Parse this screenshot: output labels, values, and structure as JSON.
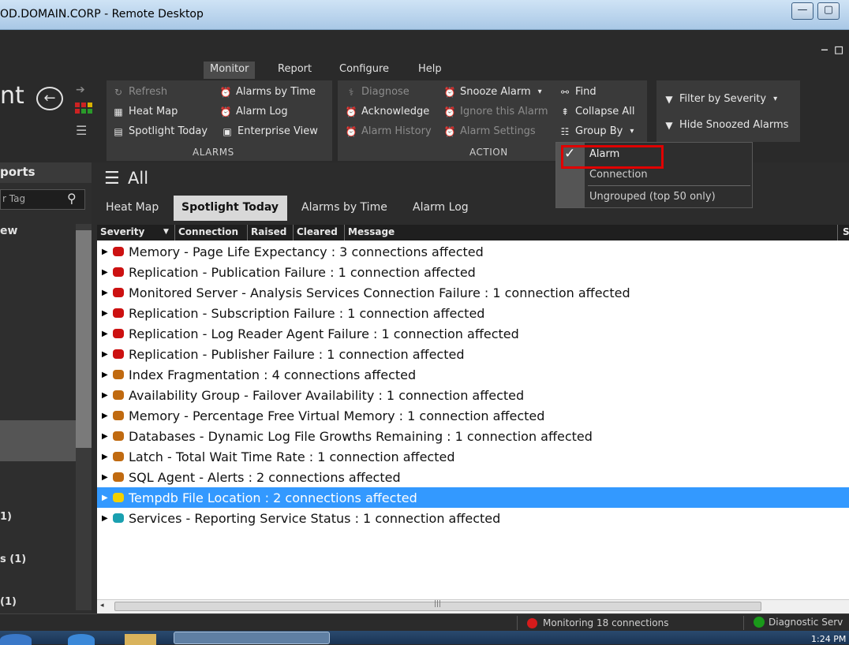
{
  "window": {
    "title": "OD.DOMAIN.CORP - Remote Desktop",
    "minimize": "—",
    "maximize": "▢"
  },
  "app": {
    "logo_fragment": "nt",
    "menu_tabs": [
      "Monitor",
      "Report",
      "Configure",
      "Help"
    ],
    "active_menu": "Monitor"
  },
  "ribbon": {
    "alarms_group": {
      "label": "ALARMS",
      "buttons": [
        {
          "label": "Refresh",
          "icon": "refresh-icon",
          "enabled": false
        },
        {
          "label": "Alarms by Time",
          "icon": "alarm-clock-icon",
          "enabled": true
        },
        {
          "label": "Heat Map",
          "icon": "heat-map-icon",
          "enabled": true
        },
        {
          "label": "Alarm Log",
          "icon": "alarm-clock-icon",
          "enabled": true
        },
        {
          "label": "Spotlight Today",
          "icon": "spotlight-today-icon",
          "enabled": true
        },
        {
          "label": "Enterprise View",
          "icon": "enterprise-view-icon",
          "enabled": true
        }
      ]
    },
    "action_group": {
      "label": "ACTION",
      "buttons": [
        {
          "label": "Diagnose",
          "icon": "diagnose-icon",
          "enabled": false
        },
        {
          "label": "Snooze Alarm",
          "icon": "snooze-icon",
          "enabled": true
        },
        {
          "label": "Find",
          "icon": "binoculars-icon",
          "enabled": true
        },
        {
          "label": "Acknowledge",
          "icon": "acknowledge-icon",
          "enabled": true
        },
        {
          "label": "Ignore this Alarm",
          "icon": "ignore-icon",
          "enabled": false
        },
        {
          "label": "Collapse All",
          "icon": "collapse-all-icon",
          "enabled": true
        },
        {
          "label": "Alarm History",
          "icon": "alarm-history-icon",
          "enabled": false
        },
        {
          "label": "Alarm Settings",
          "icon": "alarm-settings-icon",
          "enabled": false
        },
        {
          "label": "Group By",
          "icon": "group-by-icon",
          "enabled": true
        }
      ]
    },
    "filter_group": {
      "buttons": [
        {
          "label": "Filter by Severity",
          "icon": "filter-icon"
        },
        {
          "label": "Hide Snoozed Alarms",
          "icon": "filter-icon"
        }
      ]
    }
  },
  "group_by_menu": {
    "items": [
      "Alarm",
      "Connection",
      "Ungrouped (top 50 only)"
    ],
    "checked": "Alarm"
  },
  "sidebar": {
    "header": "ports",
    "search_placeholder": "r Tag",
    "view_label": "ew",
    "counts": [
      "1)",
      "s (1)",
      "(1)"
    ]
  },
  "main": {
    "heading": "All",
    "tabs": [
      "Heat Map",
      "Spotlight Today",
      "Alarms by Time",
      "Alarm Log"
    ],
    "active_tab": "Spotlight Today",
    "columns": [
      "Severity",
      "Connection",
      "Raised",
      "Cleared",
      "Message",
      "S"
    ],
    "rows": [
      {
        "text": "Memory - Page Life Expectancy : 3 connections affected",
        "severity": "high",
        "color": "#cc1111"
      },
      {
        "text": "Replication - Publication Failure : 1 connection affected",
        "severity": "high",
        "color": "#cc1111"
      },
      {
        "text": "Monitored Server - Analysis Services Connection Failure : 1 connection affected",
        "severity": "high",
        "color": "#cc1111"
      },
      {
        "text": "Replication - Subscription Failure : 1 connection affected",
        "severity": "high",
        "color": "#cc1111"
      },
      {
        "text": "Replication - Log Reader Agent Failure : 1 connection affected",
        "severity": "high",
        "color": "#cc1111"
      },
      {
        "text": "Replication - Publisher Failure : 1 connection affected",
        "severity": "high",
        "color": "#cc1111"
      },
      {
        "text": "Index Fragmentation : 4 connections affected",
        "severity": "medium",
        "color": "#c06a10"
      },
      {
        "text": "Availability Group - Failover Availability : 1 connection affected",
        "severity": "medium",
        "color": "#c06a10"
      },
      {
        "text": "Memory - Percentage Free Virtual Memory : 1 connection affected",
        "severity": "medium",
        "color": "#c06a10"
      },
      {
        "text": "Databases - Dynamic Log File Growths Remaining : 1 connection affected",
        "severity": "medium",
        "color": "#c06a10"
      },
      {
        "text": "Latch - Total Wait Time Rate : 1 connection affected",
        "severity": "medium",
        "color": "#c06a10"
      },
      {
        "text": "SQL Agent - Alerts : 2 connections affected",
        "severity": "medium",
        "color": "#c06a10"
      },
      {
        "text": "Tempdb File Location : 2 connections affected",
        "severity": "low",
        "color": "#f2d000",
        "selected": true
      },
      {
        "text": "Services - Reporting Service Status : 1 connection affected",
        "severity": "info",
        "color": "#1aa0b0"
      }
    ]
  },
  "status": {
    "monitoring": "Monitoring 18 connections",
    "diagnostic": "Diagnostic Serv",
    "clock": "1:24 PM"
  }
}
